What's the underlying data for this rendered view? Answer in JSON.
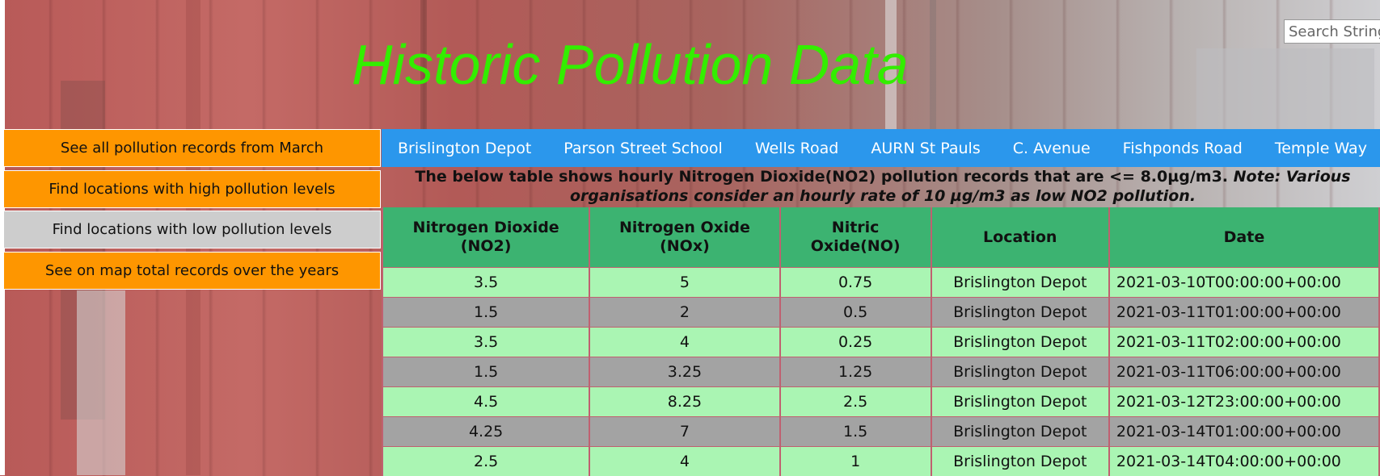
{
  "page": {
    "title": "Historic Pollution Data",
    "search_placeholder": "Search String"
  },
  "sidebar": {
    "items": [
      {
        "label": "See all pollution records from March"
      },
      {
        "label": "Find locations with high pollution levels"
      },
      {
        "label": "Find locations with low pollution levels"
      },
      {
        "label": "See on map total records over the years"
      }
    ]
  },
  "nav": {
    "items": [
      {
        "label": "Brislington Depot"
      },
      {
        "label": "Parson Street School"
      },
      {
        "label": "Wells Road"
      },
      {
        "label": "AURN St Pauls"
      },
      {
        "label": "C. Avenue"
      },
      {
        "label": "Fishponds Road"
      },
      {
        "label": "Temple Way"
      }
    ]
  },
  "description": {
    "main": "The below table shows hourly Nitrogen Dioxide(NO2) pollution records that are <= 8.0µg/m3.",
    "note": "Note: Various organisations consider an hourly rate of 10 µg/m3 as low NO2 pollution."
  },
  "table": {
    "headers": [
      "Nitrogen Dioxide (NO2)",
      "Nitrogen Oxide (NOx)",
      "Nitric Oxide(NO)",
      "Location",
      "Date"
    ],
    "rows": [
      [
        "3.5",
        "5",
        "0.75",
        "Brislington Depot",
        "2021-03-10T00:00:00+00:00"
      ],
      [
        "1.5",
        "2",
        "0.5",
        "Brislington Depot",
        "2021-03-11T01:00:00+00:00"
      ],
      [
        "3.5",
        "4",
        "0.25",
        "Brislington Depot",
        "2021-03-11T02:00:00+00:00"
      ],
      [
        "1.5",
        "3.25",
        "1.25",
        "Brislington Depot",
        "2021-03-11T06:00:00+00:00"
      ],
      [
        "4.5",
        "8.25",
        "2.5",
        "Brislington Depot",
        "2021-03-12T23:00:00+00:00"
      ],
      [
        "4.25",
        "7",
        "1.5",
        "Brislington Depot",
        "2021-03-14T01:00:00+00:00"
      ],
      [
        "2.5",
        "4",
        "1",
        "Brislington Depot",
        "2021-03-14T04:00:00+00:00"
      ]
    ]
  },
  "colors": {
    "title": "#33ee00",
    "sidebar_button": "#fe9600",
    "sidebar_button_active": "#cdcdcd",
    "nav_bar": "#2b97ec",
    "table_header": "#3cb371",
    "row_light": "#aaf5b3",
    "row_dark": "#a3a3a3"
  }
}
